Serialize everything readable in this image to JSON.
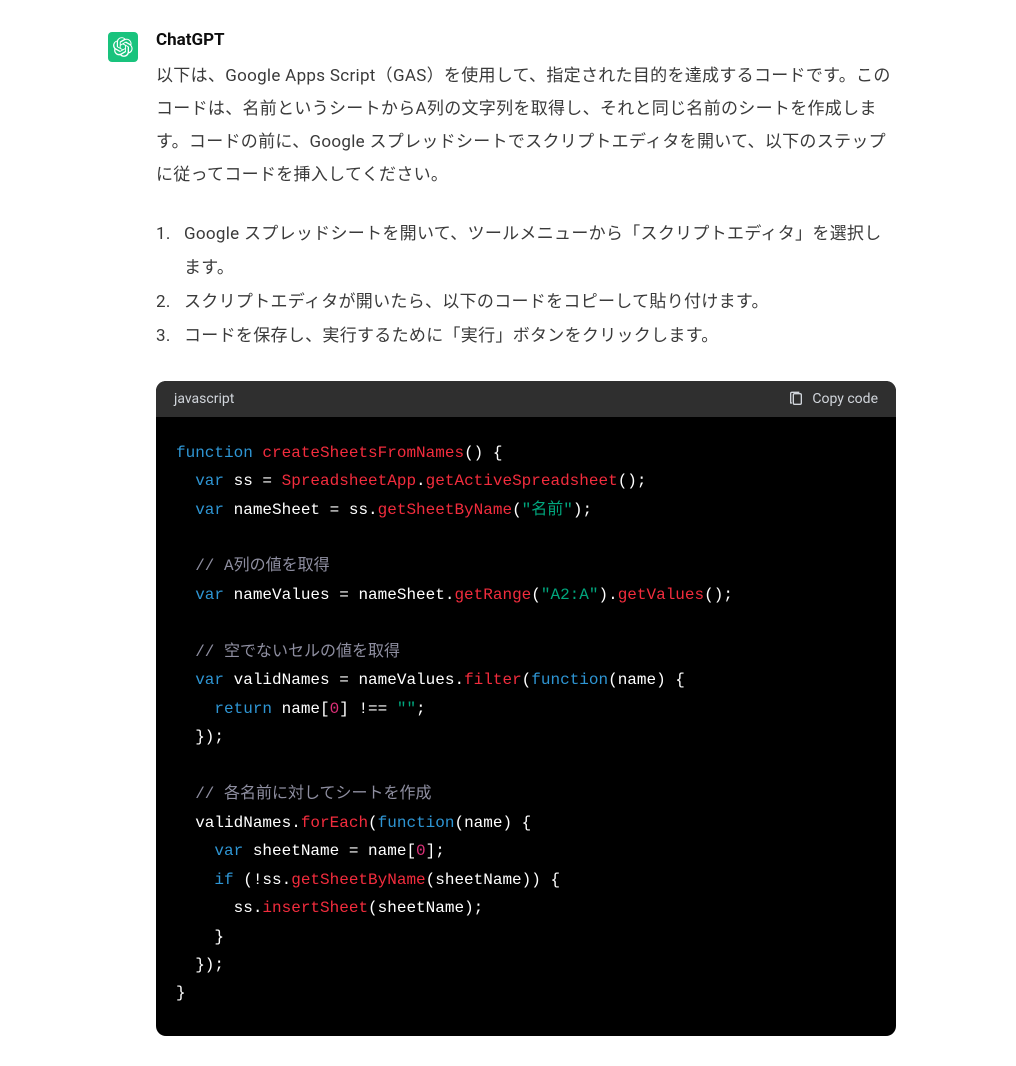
{
  "author": "ChatGPT",
  "intro": "以下は、Google Apps Script（GAS）を使用して、指定された目的を達成するコードです。このコードは、名前というシートからA列の文字列を取得し、それと同じ名前のシートを作成します。コードの前に、Google スプレッドシートでスクリプトエディタを開いて、以下のステップに従ってコードを挿入してください。",
  "steps": [
    "Google スプレッドシートを開いて、ツールメニューから「スクリプトエディタ」を選択します。",
    "スクリプトエディタが開いたら、以下のコードをコピーして貼り付けます。",
    "コードを保存し、実行するために「実行」ボタンをクリックします。"
  ],
  "code": {
    "language": "javascript",
    "copy_label": "Copy code",
    "tokens": [
      [
        [
          "kw",
          "function"
        ],
        [
          "pl",
          " "
        ],
        [
          "fn",
          "createSheetsFromNames"
        ],
        [
          "pl",
          "() {"
        ]
      ],
      [
        [
          "pl",
          "  "
        ],
        [
          "kw",
          "var"
        ],
        [
          "pl",
          " ss = "
        ],
        [
          "fn",
          "SpreadsheetApp"
        ],
        [
          "pl",
          "."
        ],
        [
          "fn",
          "getActiveSpreadsheet"
        ],
        [
          "pl",
          "();"
        ]
      ],
      [
        [
          "pl",
          "  "
        ],
        [
          "kw",
          "var"
        ],
        [
          "pl",
          " nameSheet = ss."
        ],
        [
          "fn",
          "getSheetByName"
        ],
        [
          "pl",
          "("
        ],
        [
          "str",
          "\"名前\""
        ],
        [
          "pl",
          ");"
        ]
      ],
      [
        [
          "pl",
          ""
        ]
      ],
      [
        [
          "pl",
          "  "
        ],
        [
          "cm",
          "// A列の値を取得"
        ]
      ],
      [
        [
          "pl",
          "  "
        ],
        [
          "kw",
          "var"
        ],
        [
          "pl",
          " nameValues = nameSheet."
        ],
        [
          "fn",
          "getRange"
        ],
        [
          "pl",
          "("
        ],
        [
          "str",
          "\"A2:A\""
        ],
        [
          "pl",
          ")."
        ],
        [
          "fn",
          "getValues"
        ],
        [
          "pl",
          "();"
        ]
      ],
      [
        [
          "pl",
          ""
        ]
      ],
      [
        [
          "pl",
          "  "
        ],
        [
          "cm",
          "// 空でないセルの値を取得"
        ]
      ],
      [
        [
          "pl",
          "  "
        ],
        [
          "kw",
          "var"
        ],
        [
          "pl",
          " validNames = nameValues."
        ],
        [
          "fn",
          "filter"
        ],
        [
          "pl",
          "("
        ],
        [
          "kw",
          "function"
        ],
        [
          "pl",
          "(name) {"
        ]
      ],
      [
        [
          "pl",
          "    "
        ],
        [
          "kw",
          "return"
        ],
        [
          "pl",
          " name["
        ],
        [
          "num",
          "0"
        ],
        [
          "pl",
          "] !== "
        ],
        [
          "str",
          "\"\""
        ],
        [
          "pl",
          ";"
        ]
      ],
      [
        [
          "pl",
          "  });"
        ]
      ],
      [
        [
          "pl",
          ""
        ]
      ],
      [
        [
          "pl",
          "  "
        ],
        [
          "cm",
          "// 各名前に対してシートを作成"
        ]
      ],
      [
        [
          "pl",
          "  validNames."
        ],
        [
          "fn",
          "forEach"
        ],
        [
          "pl",
          "("
        ],
        [
          "kw",
          "function"
        ],
        [
          "pl",
          "(name) {"
        ]
      ],
      [
        [
          "pl",
          "    "
        ],
        [
          "kw",
          "var"
        ],
        [
          "pl",
          " sheetName = name["
        ],
        [
          "num",
          "0"
        ],
        [
          "pl",
          "];"
        ]
      ],
      [
        [
          "pl",
          "    "
        ],
        [
          "kw",
          "if"
        ],
        [
          "pl",
          " (!ss."
        ],
        [
          "fn",
          "getSheetByName"
        ],
        [
          "pl",
          "(sheetName)) {"
        ]
      ],
      [
        [
          "pl",
          "      ss."
        ],
        [
          "fn",
          "insertSheet"
        ],
        [
          "pl",
          "(sheetName);"
        ]
      ],
      [
        [
          "pl",
          "    }"
        ]
      ],
      [
        [
          "pl",
          "  });"
        ]
      ],
      [
        [
          "pl",
          "}"
        ]
      ]
    ]
  }
}
